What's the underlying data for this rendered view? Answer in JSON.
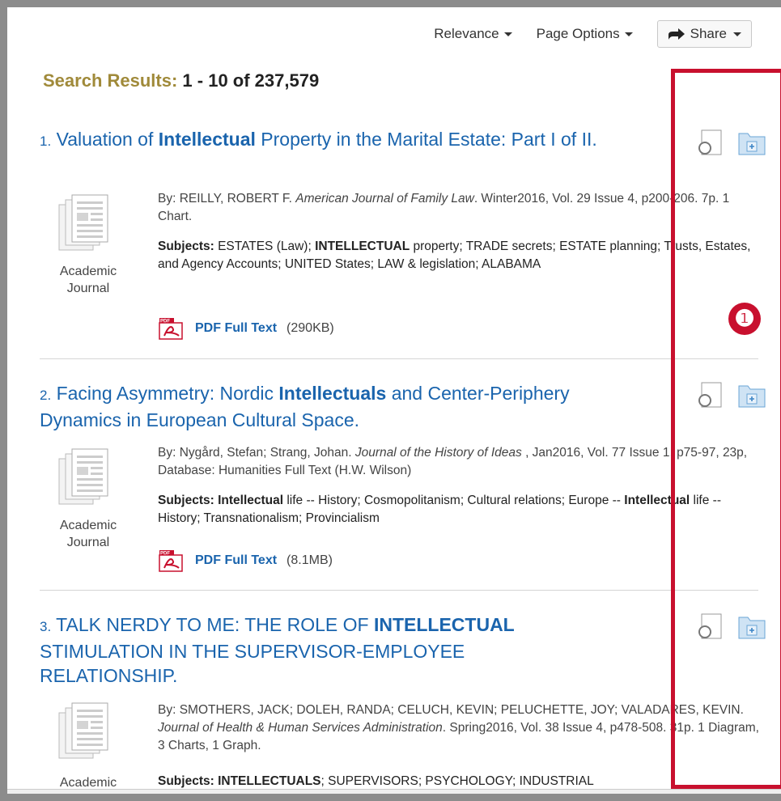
{
  "toolbar": {
    "relevance_label": "Relevance",
    "page_options_label": "Page Options",
    "share_label": "Share"
  },
  "heading": {
    "label": "Search Results:",
    "range": "1 - 10 of 237,579"
  },
  "results": [
    {
      "number": "1.",
      "title_parts": [
        "Valuation of ",
        "Intellectual",
        " Property in the Marital Estate: Part I of II."
      ],
      "type_line1": "Academic",
      "type_line2": "Journal",
      "by_prefix": "By: REILLY, ROBERT F. ",
      "source": "American Journal of Family Law",
      "by_suffix": ". Winter2016, Vol. 29 Issue 4, p200-206. 7p. 1 Chart.",
      "subjects_label": "Subjects:",
      "subjects_parts": [
        " ESTATES (Law); ",
        "INTELLECTUAL",
        " property; TRADE secrets; ESTATE planning; Trusts, Estates, and Agency Accounts; UNITED States; LAW & legislation; ALABAMA"
      ],
      "pdf_label": "PDF Full Text",
      "pdf_size": "(290KB)"
    },
    {
      "number": "2.",
      "title_parts": [
        "Facing Asymmetry: Nordic ",
        "Intellectuals",
        " and Center-Periphery Dynamics in European Cultural Space."
      ],
      "type_line1": "Academic",
      "type_line2": "Journal",
      "by_prefix": "By: Nygård, Stefan; Strang, Johan. ",
      "source": "Journal of the History of Ideas",
      "by_suffix": " , Jan2016, Vol. 77 Issue 1, p75-97, 23p, Database: Humanities Full Text (H.W. Wilson)",
      "subjects_label": "Subjects:",
      "subjects_parts": [
        " ",
        "Intellectual",
        " life -- History; Cosmopolitanism; Cultural relations; Europe -- ",
        "Intellectual",
        " life -- History; Transnationalism; Provincialism"
      ],
      "pdf_label": "PDF Full Text",
      "pdf_size": "(8.1MB)"
    },
    {
      "number": "3.",
      "title_parts": [
        "TALK NERDY TO ME: THE ROLE OF ",
        "INTELLECTUAL",
        " STIMULATION IN THE SUPERVISOR-EMPLOYEE RELATIONSHIP."
      ],
      "type_line1": "Academic",
      "by_prefix": "By: SMOTHERS, JACK; DOLEH, RANDA; CELUCH, KEVIN; PELUCHETTE, JOY; VALADARES, KEVIN. ",
      "source": "Journal of Health & Human Services Administration",
      "by_suffix": ". Spring2016, Vol. 38 Issue 4, p478-508. 31p. 1 Diagram, 3 Charts, 1 Graph.",
      "subjects_label": "Subjects:",
      "subjects_parts": [
        " ",
        "INTELLECTUALS",
        "; SUPERVISORS; PSYCHOLOGY; INDUSTRIAL"
      ]
    }
  ],
  "annotation": {
    "marker": "❶",
    "color": "#c8102e"
  },
  "icons": {
    "preview": "magnifier-page-icon",
    "add_folder": "add-to-folder-icon",
    "pdf": "pdf-icon",
    "share": "share-arrow-icon",
    "publication": "academic-journal-icon"
  }
}
